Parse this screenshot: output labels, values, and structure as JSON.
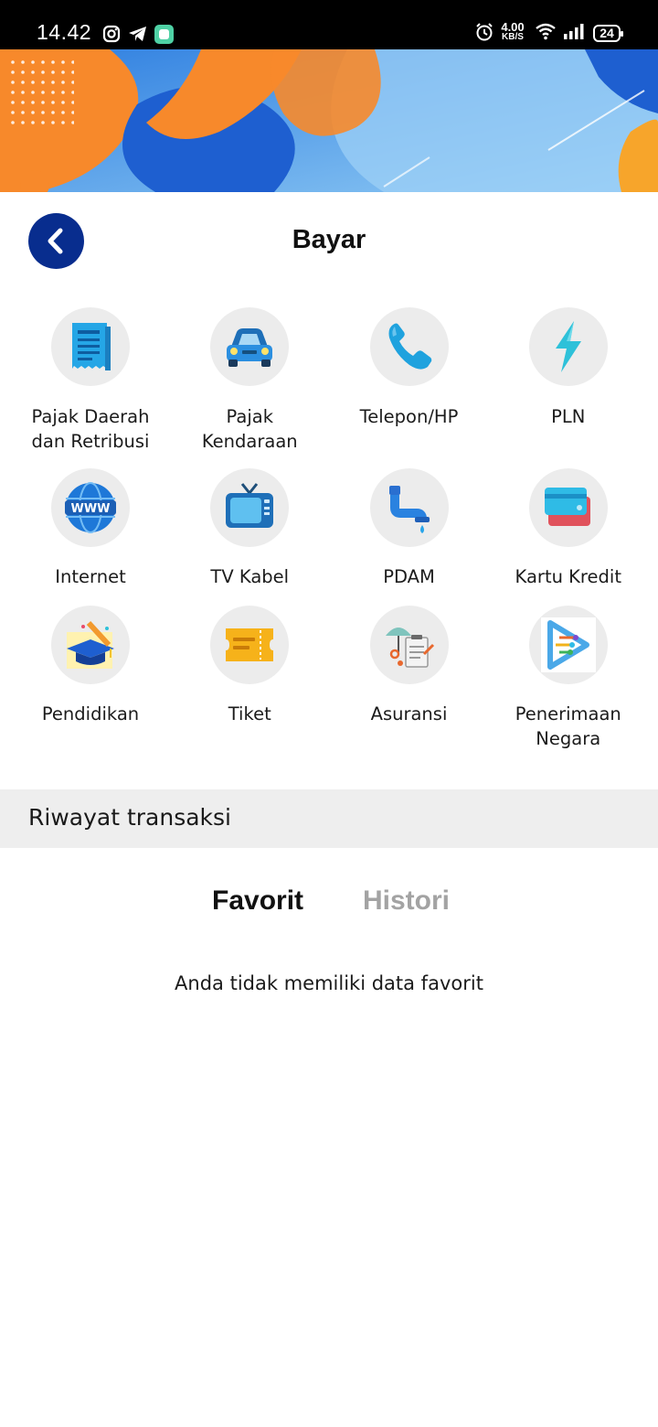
{
  "status_bar": {
    "time": "14.42",
    "net_speed_value": "4.00",
    "net_speed_unit": "KB/S",
    "battery": "24",
    "icons": [
      "instagram-icon",
      "telegram-icon",
      "app-icon",
      "alarm-icon",
      "wifi-icon",
      "signal-icon",
      "battery-icon"
    ]
  },
  "header": {
    "title": "Bayar",
    "back_icon": "chevron-left-icon"
  },
  "menu": [
    {
      "label": "Pajak Daerah\ndan Retribusi",
      "icon": "receipt-icon"
    },
    {
      "label": "Pajak\nKendaraan",
      "icon": "car-icon"
    },
    {
      "label": "Telepon/HP",
      "icon": "phone-icon"
    },
    {
      "label": "PLN",
      "icon": "lightning-icon"
    },
    {
      "label": "Internet",
      "icon": "globe-www-icon"
    },
    {
      "label": "TV Kabel",
      "icon": "tv-icon"
    },
    {
      "label": "PDAM",
      "icon": "water-tap-icon"
    },
    {
      "label": "Kartu Kredit",
      "icon": "credit-card-icon"
    },
    {
      "label": "Pendidikan",
      "icon": "graduation-cap-icon"
    },
    {
      "label": "Tiket",
      "icon": "ticket-icon"
    },
    {
      "label": "Asuransi",
      "icon": "insurance-icon"
    },
    {
      "label": "Penerimaan\nNegara",
      "icon": "state-revenue-icon"
    }
  ],
  "history": {
    "section_title": "Riwayat transaksi",
    "tabs": [
      {
        "label": "Favorit",
        "active": true
      },
      {
        "label": "Histori",
        "active": false
      }
    ],
    "empty_message": "Anda tidak memiliki data favorit"
  },
  "colors": {
    "primary": "#082d8e",
    "section_bg": "#eeeeee",
    "tab_inactive": "#a3a3a3",
    "icon_bg": "#ececec"
  }
}
